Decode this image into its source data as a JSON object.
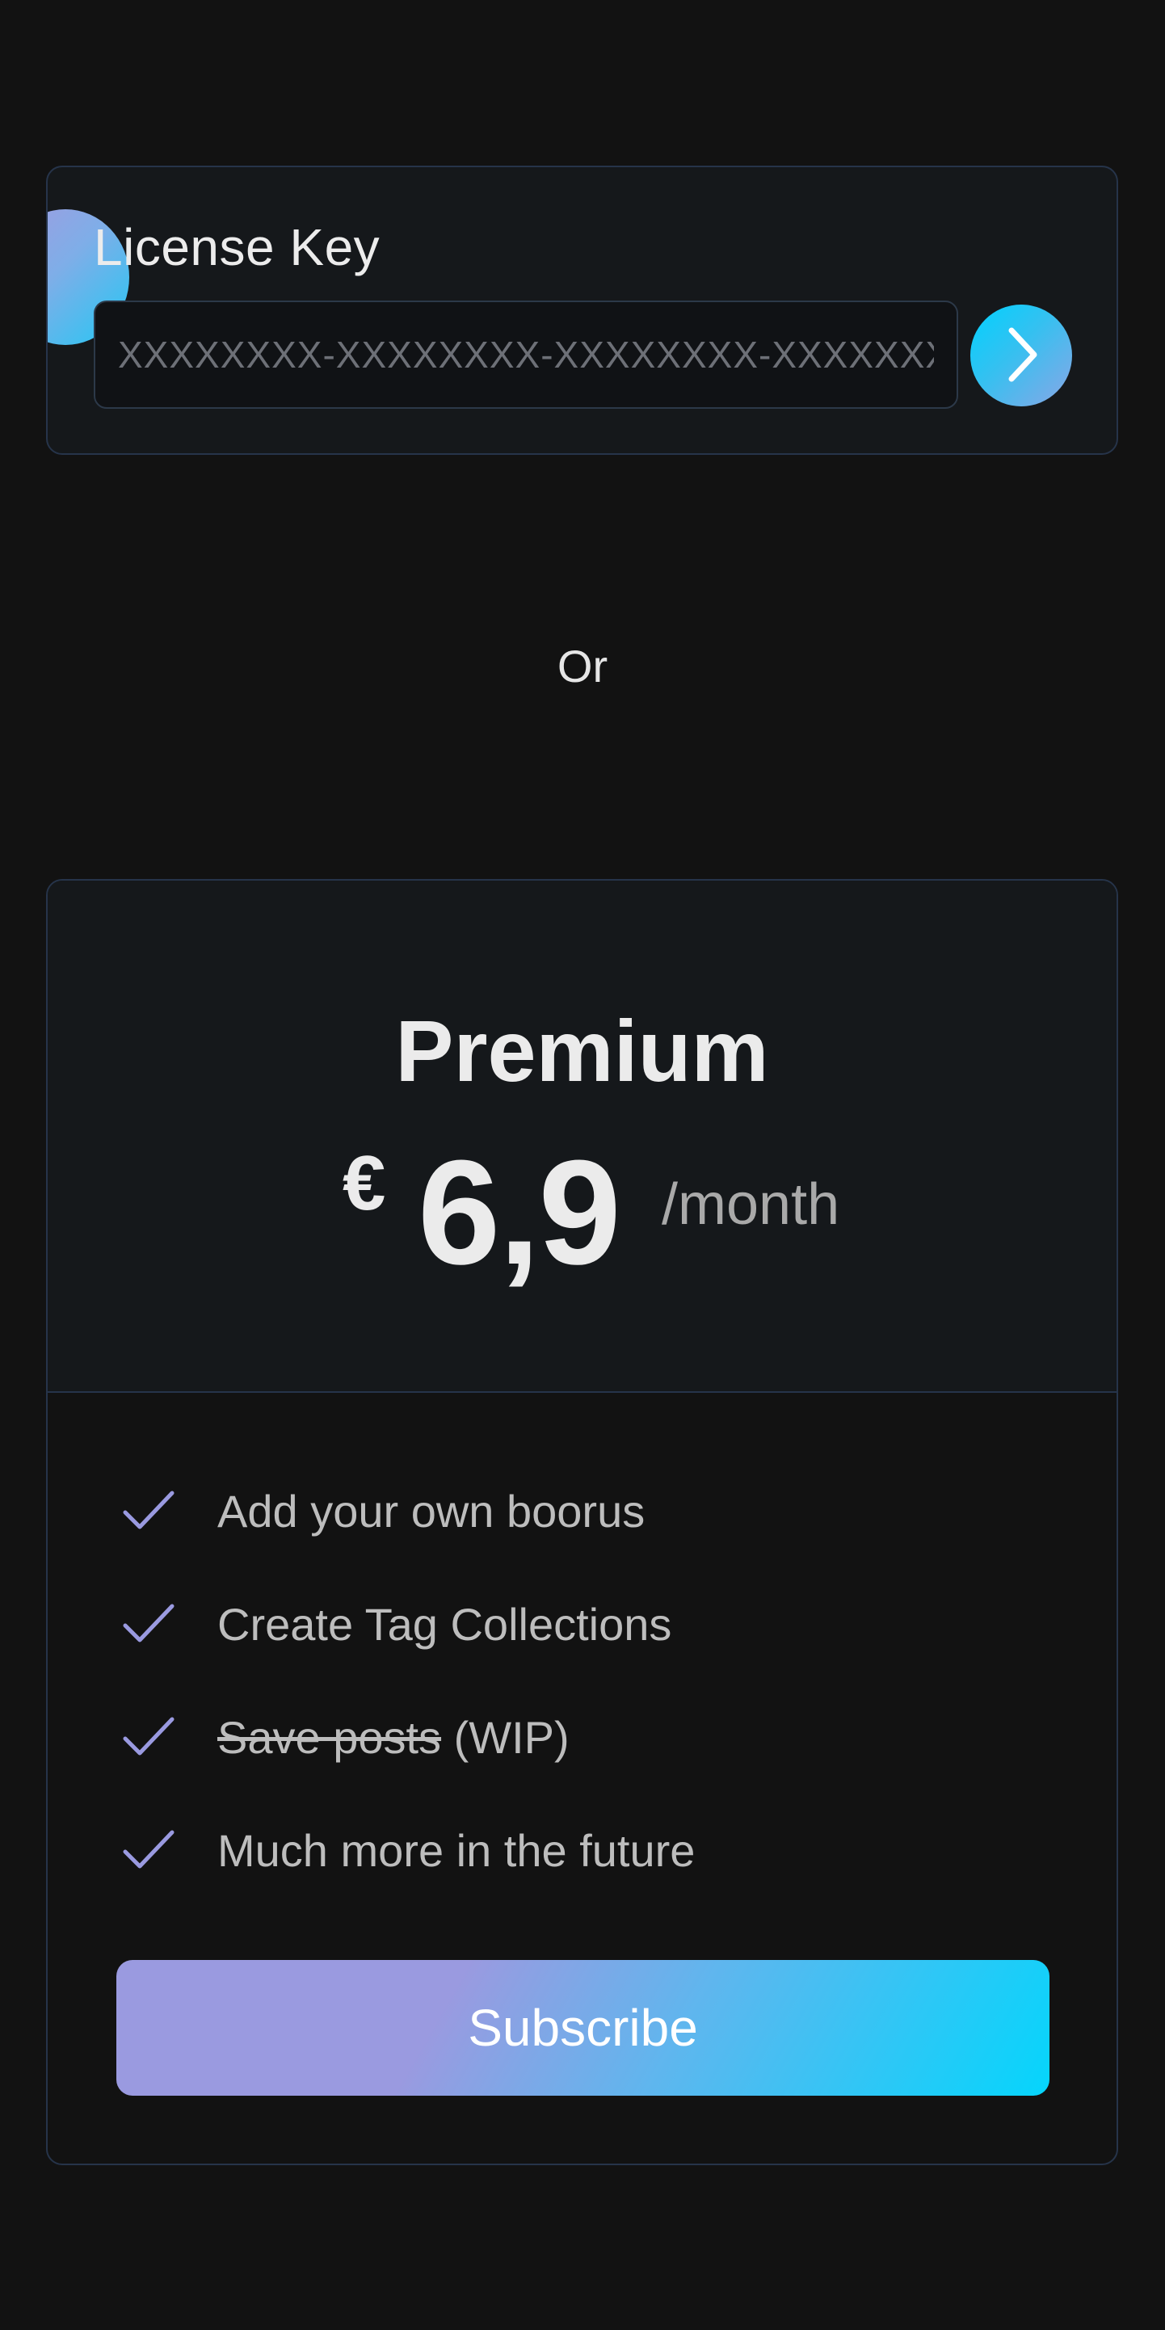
{
  "license": {
    "title": "License Key",
    "placeholder": "XXXXXXXX-XXXXXXXX-XXXXXXXX-XXXXXXXX",
    "value": ""
  },
  "divider_text": "Or",
  "plan": {
    "name": "Premium",
    "currency": "€",
    "amount": "6,9",
    "period": "/month",
    "features": [
      {
        "text": "Add your own boorus",
        "struck": ""
      },
      {
        "text": "Create Tag Collections",
        "struck": ""
      },
      {
        "struck": "Save posts",
        "text": " (WIP)"
      },
      {
        "text": "Much more in the future",
        "struck": ""
      }
    ],
    "cta": "Subscribe"
  },
  "colors": {
    "background": "#121212",
    "card": "#15181b",
    "border": "#26344a",
    "accent_start": "#9a9ae0",
    "accent_end": "#05d5fc",
    "check": "#9a9ae0"
  },
  "icons": {
    "go": "chevron-right-icon",
    "feature": "check-icon"
  }
}
